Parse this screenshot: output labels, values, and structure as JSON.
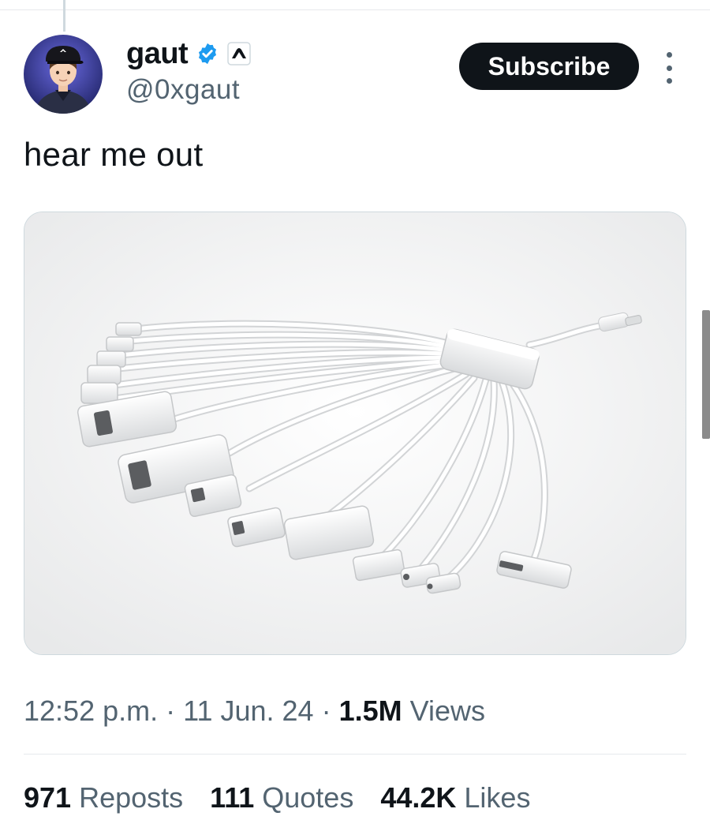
{
  "author": {
    "display_name": "gaut",
    "handle": "@0xgaut",
    "verified_icon": "verified-badge-icon",
    "affiliate_icon": "affiliate-badge-icon",
    "avatar_icon": "avatar-cap-guy"
  },
  "actions": {
    "subscribe_label": "Subscribe",
    "more_icon": "more-vertical-icon"
  },
  "tweet": {
    "text": "hear me out",
    "media_icon": "photo-multi-adapter-cable"
  },
  "meta": {
    "time": "12:52 p.m.",
    "sep1": " · ",
    "date": "11 Jun. 24",
    "sep2": " · ",
    "views_count": "1.5M",
    "views_label": " Views"
  },
  "stats": [
    {
      "count": "971",
      "label": "Reposts"
    },
    {
      "count": "111",
      "label": "Quotes"
    },
    {
      "count": "44.2K",
      "label": "Likes"
    }
  ],
  "colors": {
    "text_primary": "#0f1419",
    "text_secondary": "#536471",
    "verified_blue": "#1d9bf0",
    "button_bg": "#0f1419",
    "divider": "#e6e9ec"
  }
}
